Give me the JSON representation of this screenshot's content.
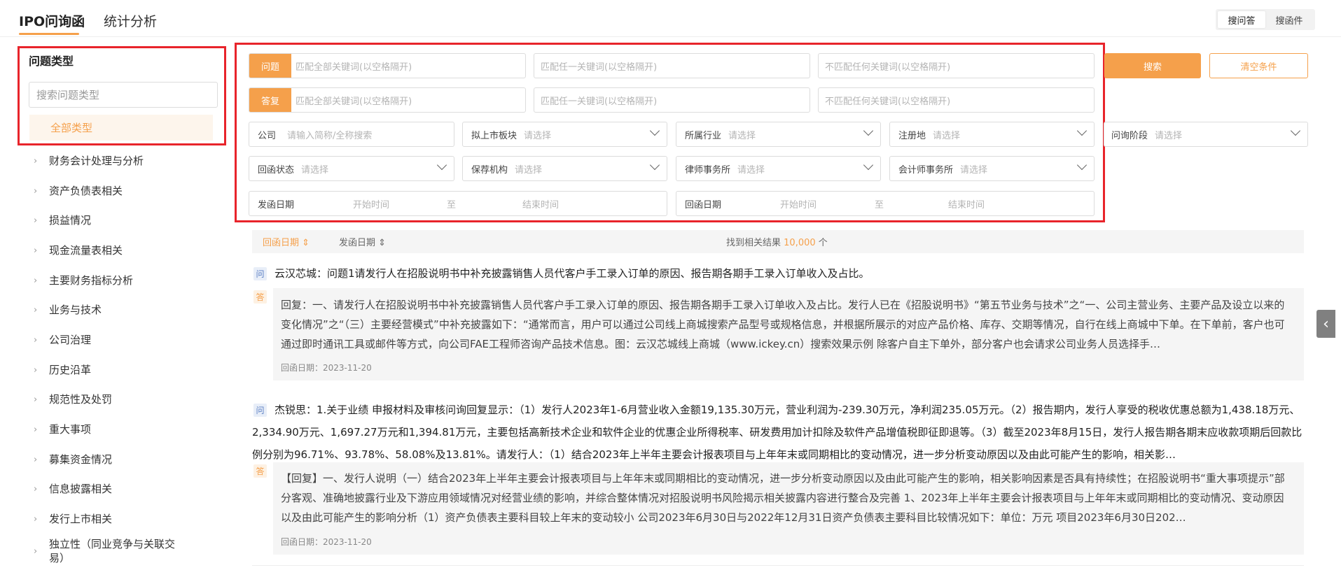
{
  "top_tabs": [
    "IPO问询函",
    "统计分析"
  ],
  "mode_toggle": [
    "搜问答",
    "搜函件"
  ],
  "sidebar": {
    "title": "问题类型",
    "search_placeholder": "搜索问题类型",
    "all_label": "全部类型",
    "items": [
      "财务会计处理与分析",
      "资产负债表相关",
      "损益情况",
      "现金流量表相关",
      "主要财务指标分析",
      "业务与技术",
      "公司治理",
      "历史沿革",
      "规范性及处罚",
      "重大事项",
      "募集资金情况",
      "信息披露相关",
      "发行上市相关",
      "独立性（同业竞争与关联交易）"
    ]
  },
  "filters": {
    "question_pill": "问题",
    "answer_pill": "答复",
    "kw_all_placeholder": "匹配全部关键词(以空格隔开)",
    "kw_any_placeholder": "匹配任一关键词(以空格隔开)",
    "kw_none_placeholder": "不匹配任何关键词(以空格隔开)",
    "company_label": "公司",
    "company_placeholder": "请输入简称/全称搜索",
    "board_label": "拟上市板块",
    "industry_label": "所属行业",
    "region_label": "注册地",
    "stage_label": "问询阶段",
    "reply_status_label": "回函状态",
    "sponsor_label": "保荐机构",
    "law_firm_label": "律师事务所",
    "accounting_firm_label": "会计师事务所",
    "select_placeholder": "请选择",
    "issue_date_label": "发函日期",
    "reply_date_label": "回函日期",
    "start_placeholder": "开始时间",
    "to": "至",
    "end_placeholder": "结束时间",
    "search_button": "搜索",
    "clear_button": "清空条件"
  },
  "sortbar": {
    "sort_reply": "回函日期",
    "sort_issue": "发函日期",
    "found_prefix": "找到相关结果",
    "found_count": "10,000",
    "found_suffix": "个"
  },
  "results": [
    {
      "q_mark": "问",
      "a_mark": "答",
      "question": "云汉芯城：问题1请发行人在招股说明书中补充披露销售人员代客户手工录入订单的原因、报告期各期手工录入订单收入及占比。",
      "answer": "回复：一、请发行人在招股说明书中补充披露销售人员代客户手工录入订单的原因、报告期各期手工录入订单收入及占比。发行人已在《招股说明书》“第五节业务与技术”之“一、公司主营业务、主要产品及设立以来的变化情况”之“（三）主要经营模式”中补充披露如下：“通常而言，用户可以通过公司线上商城搜索产品型号或规格信息，并根据所展示的对应产品价格、库存、交期等情况，自行在线上商城中下单。在下单前，客户也可通过即时通讯工具或邮件等方式，向公司FAE工程师咨询产品技术信息。图：云汉芯城线上商城（www.ickey.cn）搜索效果示例 除客户自主下单外，部分客户也会请求公司业务人员选择手…",
      "date": "回函日期：2023-11-20"
    },
    {
      "q_mark": "问",
      "a_mark": "答",
      "question": "杰锐思：1.关于业绩 申报材料及审核问询回复显示：（1）发行人2023年1-6月营业收入金额19,135.30万元，营业利润为-239.30万元，净利润235.05万元。（2）报告期内，发行人享受的税收优惠总额为1,438.18万元、2,334.90万元、1,697.27万元和1,394.81万元，主要包括高新技术企业和软件企业的优惠企业所得税率、研发费用加计扣除及软件产品增值税即征即退等。（3）截至2023年8月15日，发行人报告期各期末应收款项期后回款比例分别为96.71%、93.78%、58.08%及13.81%。请发行人：（1）结合2023年上半年主要会计报表项目与上年年末或同期相比的变动情况，进一步分析变动原因以及由此可能产生的影响，相关影…",
      "answer": "【回复】一、发行人说明（一）结合2023年上半年主要会计报表项目与上年年末或同期相比的变动情况，进一步分析变动原因以及由此可能产生的影响，相关影响因素是否具有持续性；在招股说明书“重大事项提示”部分客观、准确地披露行业及下游应用领域情况对经营业绩的影响，并综合整体情况对招股说明书风险揭示相关披露内容进行整合及完善 1、2023年上半年主要会计报表项目与上年年末或同期相比的变动情况、变动原因以及由此可能产生的影响分析（1）资产负债表主要科目较上年末的变动较小 公司2023年6月30日与2022年12月31日资产负债表主要科目比较情况如下：单位：万元 项目2023年6月30日202…",
      "date": "回函日期：2023-11-20"
    }
  ],
  "colors": {
    "accent": "#f5a04b",
    "highlight": "#e8242b"
  },
  "icons": {
    "sort_icon": "sort-updown-icon",
    "chevron": "chevron-right-icon",
    "dropdown": "chevron-down-icon",
    "handle": "chevron-left-icon"
  }
}
